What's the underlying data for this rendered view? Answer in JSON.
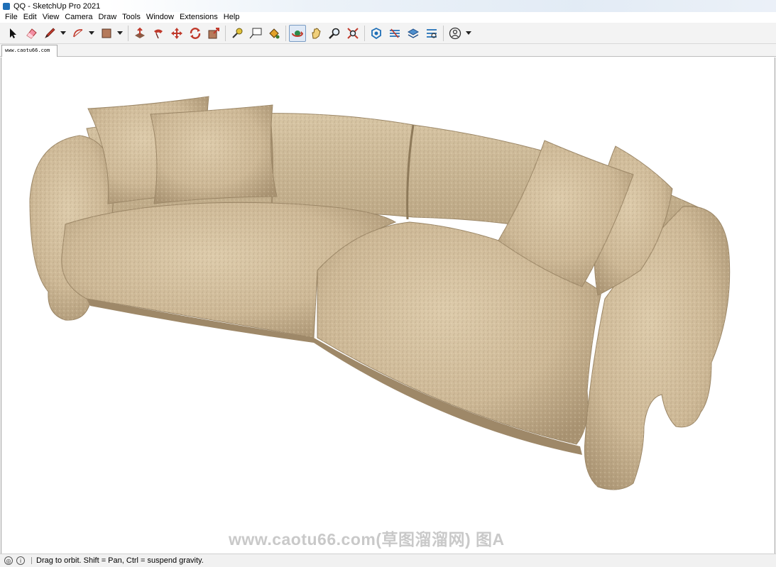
{
  "window": {
    "title": "QQ - SketchUp Pro 2021",
    "app_icon": "sketchup-icon"
  },
  "menu": [
    "File",
    "Edit",
    "View",
    "Camera",
    "Draw",
    "Tools",
    "Window",
    "Extensions",
    "Help"
  ],
  "toolbar": {
    "tools": [
      {
        "name": "select-tool",
        "icon": "cursor-arrow-icon"
      },
      {
        "name": "eraser-tool",
        "icon": "eraser-icon"
      },
      {
        "name": "line-tool",
        "icon": "pencil-icon",
        "dropdown": true
      },
      {
        "name": "arc-tool",
        "icon": "arc-icon",
        "dropdown": true
      },
      {
        "name": "rectangle-tool",
        "icon": "rectangle-icon",
        "dropdown": true
      },
      {
        "name": "push-pull-tool",
        "icon": "push-pull-icon"
      },
      {
        "name": "follow-me-tool",
        "icon": "follow-me-icon"
      },
      {
        "name": "move-tool",
        "icon": "move-icon"
      },
      {
        "name": "rotate-tool",
        "icon": "rotate-icon"
      },
      {
        "name": "scale-tool",
        "icon": "scale-icon"
      },
      {
        "name": "tape-measure-tool",
        "icon": "tape-measure-icon"
      },
      {
        "name": "text-tool",
        "icon": "text-icon"
      },
      {
        "name": "paint-bucket-tool",
        "icon": "paint-bucket-icon"
      },
      {
        "name": "orbit-tool",
        "icon": "orbit-icon",
        "active": true
      },
      {
        "name": "pan-tool",
        "icon": "pan-hand-icon"
      },
      {
        "name": "zoom-tool",
        "icon": "zoom-icon"
      },
      {
        "name": "zoom-extents-tool",
        "icon": "zoom-extents-icon"
      },
      {
        "name": "3d-warehouse",
        "icon": "warehouse-icon"
      },
      {
        "name": "extension-warehouse",
        "icon": "extension-warehouse-icon"
      },
      {
        "name": "layout-send",
        "icon": "layout-icon"
      },
      {
        "name": "extension-manager",
        "icon": "extension-manager-icon"
      },
      {
        "name": "account",
        "icon": "user-account-icon",
        "dropdown": true
      }
    ]
  },
  "scene_tab": {
    "label": "www.caotu66.com"
  },
  "viewport": {
    "model": "curved-sofa",
    "watermark": "www.caotu66.com(草图溜溜网) 图A",
    "colors": {
      "fabric": "#cdb896",
      "fabric_shadow": "#a99372",
      "fabric_light": "#ddcbab"
    }
  },
  "status": {
    "text": "Drag to orbit. Shift = Pan, Ctrl = suspend gravity.",
    "icons": [
      "geo-location-icon",
      "info-icon"
    ]
  }
}
